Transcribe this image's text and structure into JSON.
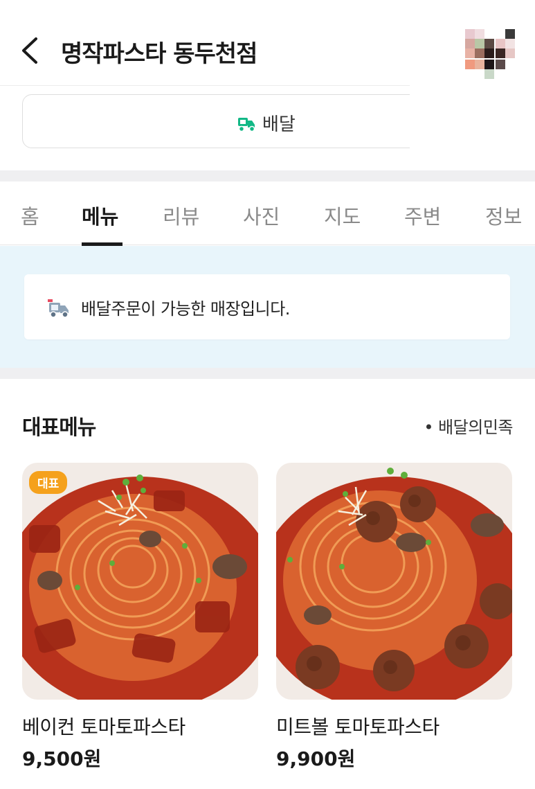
{
  "header": {
    "title": "명작파스타 동두천점"
  },
  "delivery_button": {
    "label": "배달"
  },
  "tabs": [
    {
      "label": "홈",
      "active": false
    },
    {
      "label": "메뉴",
      "active": true
    },
    {
      "label": "리뷰",
      "active": false
    },
    {
      "label": "사진",
      "active": false
    },
    {
      "label": "지도",
      "active": false
    },
    {
      "label": "주변",
      "active": false
    },
    {
      "label": "정보",
      "active": false
    }
  ],
  "notice": {
    "text": "배달주문이 가능한 매장입니다."
  },
  "section": {
    "title": "대표메뉴",
    "source": "• 배달의민족"
  },
  "menus": [
    {
      "name": "베이컨 토마토파스타",
      "price": "9,500원",
      "badge": "대표"
    },
    {
      "name": "미트볼 토마토파스타",
      "price": "9,900원"
    }
  ],
  "colors": {
    "accent_green": "#12b886",
    "badge_orange": "#f5a11c",
    "notice_bg": "#e8f5fb"
  }
}
